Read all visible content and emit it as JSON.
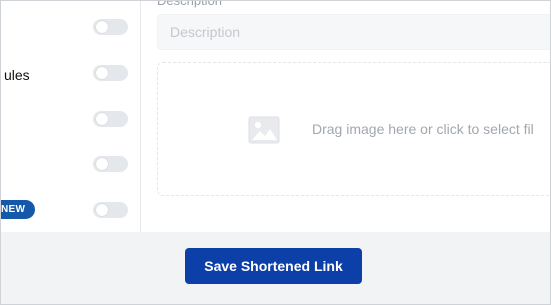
{
  "settings": {
    "toggles": [
      {
        "label": "",
        "on": false
      },
      {
        "label": "ules",
        "on": false
      },
      {
        "label": "",
        "on": false
      },
      {
        "label": "",
        "on": false
      },
      {
        "label": "",
        "on": false,
        "badge": "NEW"
      }
    ]
  },
  "form": {
    "description_label": "Description",
    "description_value": "",
    "description_placeholder": "Description",
    "image_drop_text": "Drag image here or click to select fil"
  },
  "footer": {
    "save_label": "Save Shortened Link"
  },
  "colors": {
    "accent": "#0d3fa8",
    "badge": "#1557a8",
    "footer_bg": "#f2f3f5"
  }
}
